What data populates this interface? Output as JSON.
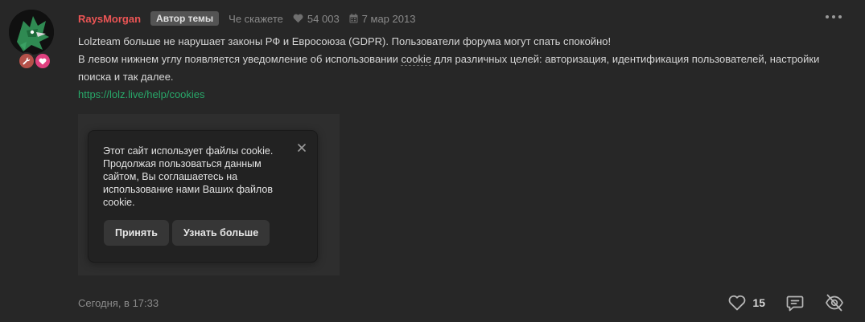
{
  "post": {
    "username": "RaysMorgan",
    "author_badge": "Автор темы",
    "user_title": "Че скажете",
    "views": "54 003",
    "date": "7 мар 2013",
    "body": {
      "line1": "Lolzteam больше не нарушает законы РФ и Евросоюза (GDPR). Пользователи форума могут спать спокойно!",
      "line2_before": "В левом нижнем углу появляется уведомление об использовании ",
      "line2_cookie": "cookie",
      "line2_after": " для различных целей: авторизация, идентификация пользователей, настройки поиска и так далее.",
      "link": "https://lolz.live/help/cookies"
    },
    "cookie_notice": {
      "text": "Этот сайт использует файлы cookie. Продолжая пользоваться данным сайтом, Вы соглашаетесь на использование нами Ваших файлов cookie.",
      "accept_label": "Принять",
      "learn_more_label": "Узнать больше"
    },
    "footer": {
      "time": "Сегодня, в 17:33",
      "likes": "15"
    }
  },
  "colors": {
    "background": "#272727",
    "username": "#ec5555",
    "link": "#28a769",
    "muted": "#8a8a8a"
  },
  "icons": [
    "tools-badge-icon",
    "heart-badge-icon",
    "heart-icon",
    "calendar-icon",
    "more-icon",
    "close-icon",
    "like-icon",
    "reply-icon",
    "hide-icon"
  ]
}
